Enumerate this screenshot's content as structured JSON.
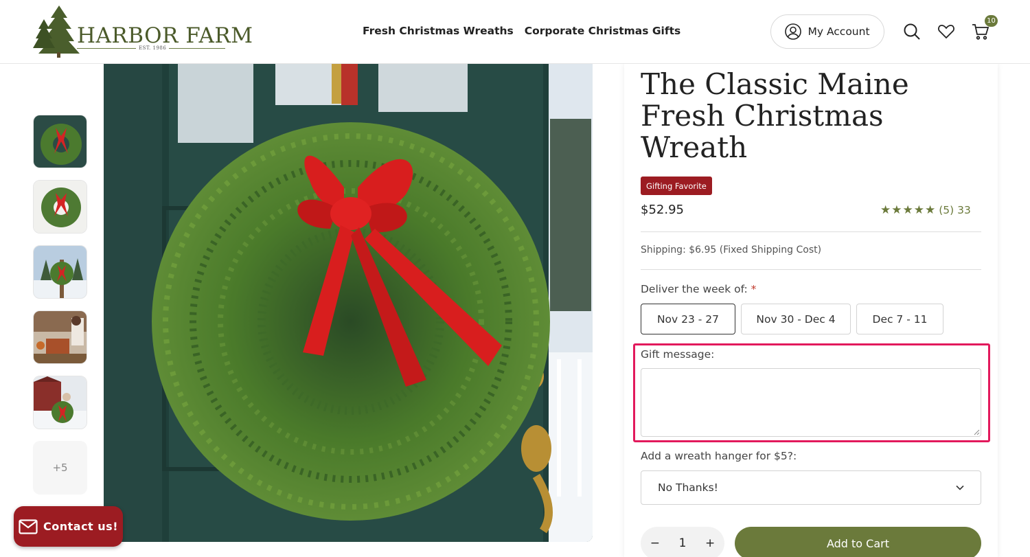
{
  "header": {
    "logo_text": "HARBOR FARM",
    "logo_est": "EST. 1986",
    "nav": [
      "Fresh Christmas Wreaths",
      "Corporate Christmas Gifts"
    ],
    "account_label": "My Account",
    "cart_count": "10"
  },
  "gallery": {
    "more_label": "+5"
  },
  "contact": {
    "label": "Contact us!"
  },
  "product": {
    "title": "The Classic Maine Fresh Christmas Wreath",
    "badge": "Gifting Favorite",
    "price": "$52.95",
    "rating_stars": "★★★★★",
    "rating_text": "(5) 33",
    "rating_value": 5,
    "shipping": "Shipping: $6.95 (Fixed Shipping Cost)",
    "deliver_label": "Deliver the week of:",
    "required_mark": "*",
    "weeks": [
      "Nov 23 - 27",
      "Nov 30 - Dec 4",
      "Dec 7 - 11"
    ],
    "selected_week": "Nov 23 - 27",
    "gift_label": "Gift message:",
    "gift_value": "",
    "hanger_label": "Add a wreath hanger for $5?:",
    "hanger_selected": "No Thanks!",
    "qty_minus": "−",
    "qty_value": "1",
    "qty_plus": "+",
    "add_to_cart": "Add to Cart"
  },
  "colors": {
    "accent_green": "#6b7a3b",
    "brand_red": "#9c1c22",
    "highlight_pink": "#e2195c"
  }
}
